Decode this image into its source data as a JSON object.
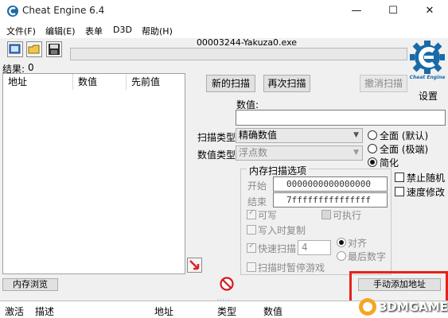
{
  "window": {
    "title": "Cheat Engine 6.4",
    "minimize_glyph": "—",
    "maximize_glyph": "☐",
    "close_glyph": "✕"
  },
  "menu": [
    "文件(F)",
    "编辑(E)",
    "表单",
    "D3D",
    "帮助(H)"
  ],
  "toolbar": {
    "icons": [
      "open-process-icon",
      "open-file-icon",
      "save-icon"
    ]
  },
  "process": {
    "name": "00003244-Yakuza0.exe"
  },
  "settings_label": "设置",
  "logo_text": "Cheat Engine",
  "results": {
    "label": "结果:",
    "count": "0",
    "columns": [
      "地址",
      "数值",
      "先前值"
    ]
  },
  "scan_buttons": {
    "first": "新的扫描",
    "next": "再次扫描",
    "cancel": "撤消扫描"
  },
  "value": {
    "label": "数值:",
    "input": ""
  },
  "scan_type": {
    "label": "扫描类型",
    "selected": "精确数值"
  },
  "value_type": {
    "label": "数值类型",
    "selected": "浮点数"
  },
  "radios": [
    {
      "label": "全面 (默认)",
      "checked": false
    },
    {
      "label": "全面 (极端)",
      "checked": false
    },
    {
      "label": "简化",
      "checked": true
    }
  ],
  "right_checks": [
    {
      "label": "禁止随机"
    },
    {
      "label": "速度修改"
    }
  ],
  "mem_options": {
    "title": "内存扫描选项",
    "start_label": "开始",
    "start_value": "0000000000000000",
    "stop_label": "结束",
    "stop_value": "7fffffffffffffff",
    "writable": "可写",
    "executable": "可执行",
    "copy_on_write": "写入时复制",
    "fast_scan": "快速扫描",
    "fast_value": "4",
    "alignment": "对齐",
    "last_digits": "最后数字",
    "pause": "扫描时暂停游戏"
  },
  "memory_view_button": "内存浏览",
  "add_address_button": "手动添加地址",
  "address_list": {
    "columns": [
      "激活",
      "描述",
      "地址",
      "类型",
      "数值"
    ]
  },
  "watermark": {
    "text": "3DMGAME"
  },
  "colors": {
    "accent_red": "#e5231a",
    "logo_blue": "#1a6aa8"
  }
}
